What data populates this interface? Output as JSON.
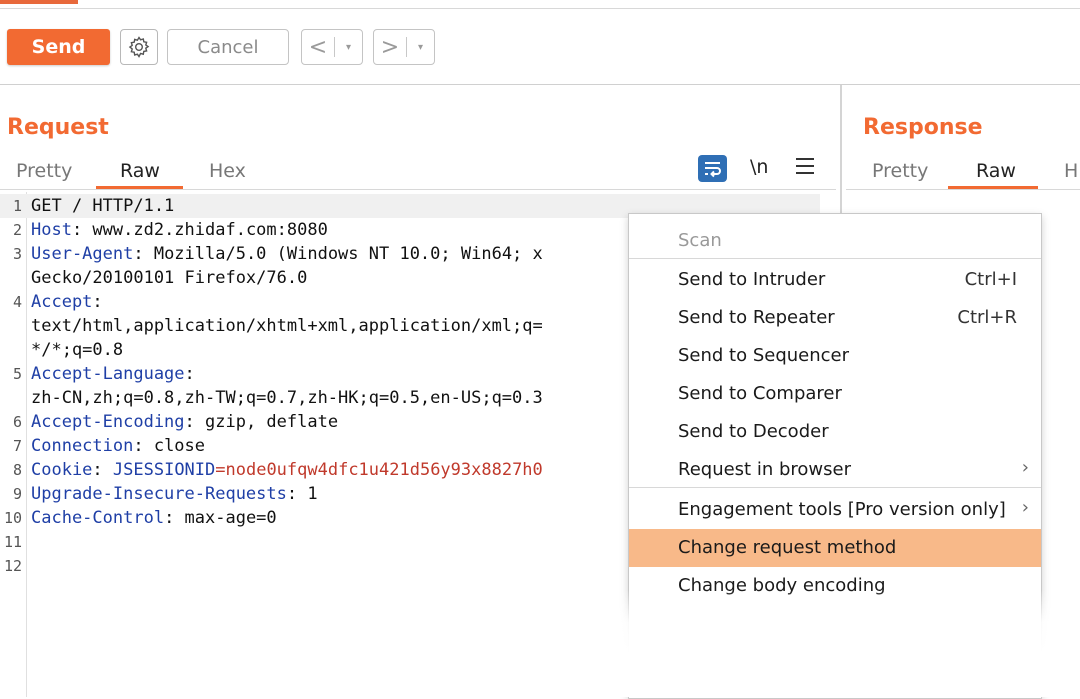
{
  "toolbar": {
    "send_label": "Send",
    "cancel_label": "Cancel",
    "back_arrow": "<",
    "forward_arrow": ">",
    "dropdown_glyph": "▾"
  },
  "request": {
    "title": "Request",
    "tabs": [
      {
        "label": "Pretty",
        "active": false
      },
      {
        "label": "Raw",
        "active": true
      },
      {
        "label": "Hex",
        "active": false
      }
    ],
    "newline_toggle": "\\n",
    "lines": [
      {
        "n": "1",
        "parts": [
          {
            "t": "GET / HTTP/1.1",
            "c": "v"
          }
        ]
      },
      {
        "n": "2",
        "parts": [
          {
            "t": "Host",
            "c": "k"
          },
          {
            "t": ": www.zd2.zhidaf.com:8080",
            "c": "v"
          }
        ]
      },
      {
        "n": "3",
        "parts": [
          {
            "t": "User-Agent",
            "c": "k"
          },
          {
            "t": ": Mozilla/5.0 (Windows NT 10.0; Win64; x",
            "c": "v"
          }
        ]
      },
      {
        "n": "",
        "parts": [
          {
            "t": "Gecko/20100101 Firefox/76.0",
            "c": "v"
          }
        ]
      },
      {
        "n": "4",
        "parts": [
          {
            "t": "Accept",
            "c": "k"
          },
          {
            "t": ":",
            "c": "v"
          }
        ]
      },
      {
        "n": "",
        "parts": [
          {
            "t": "text/html,application/xhtml+xml,application/xml;q=",
            "c": "v"
          }
        ]
      },
      {
        "n": "",
        "parts": [
          {
            "t": "*/*;q=0.8",
            "c": "v"
          }
        ]
      },
      {
        "n": "5",
        "parts": [
          {
            "t": "Accept-Language",
            "c": "k"
          },
          {
            "t": ":",
            "c": "v"
          }
        ]
      },
      {
        "n": "",
        "parts": [
          {
            "t": "zh-CN,zh;q=0.8,zh-TW;q=0.7,zh-HK;q=0.5,en-US;q=0.3",
            "c": "v"
          }
        ]
      },
      {
        "n": "6",
        "parts": [
          {
            "t": "Accept-Encoding",
            "c": "k"
          },
          {
            "t": ": gzip, deflate",
            "c": "v"
          }
        ]
      },
      {
        "n": "7",
        "parts": [
          {
            "t": "Connection",
            "c": "k"
          },
          {
            "t": ": close",
            "c": "v"
          }
        ]
      },
      {
        "n": "8",
        "parts": [
          {
            "t": "Cookie",
            "c": "k"
          },
          {
            "t": ": ",
            "c": "v"
          },
          {
            "t": "JSESSIONID",
            "c": "k"
          },
          {
            "t": "=node0ufqw4dfc1u421d56y93x8827h0",
            "c": "r"
          }
        ]
      },
      {
        "n": "9",
        "parts": [
          {
            "t": "Upgrade-Insecure-Requests",
            "c": "k"
          },
          {
            "t": ": 1",
            "c": "v"
          }
        ]
      },
      {
        "n": "10",
        "parts": [
          {
            "t": "Cache-Control",
            "c": "k"
          },
          {
            "t": ": max-age=0",
            "c": "v"
          }
        ]
      },
      {
        "n": "11",
        "parts": []
      },
      {
        "n": "12",
        "parts": []
      }
    ]
  },
  "response": {
    "title": "Response",
    "tabs": [
      {
        "label": "Pretty",
        "active": false
      },
      {
        "label": "Raw",
        "active": true
      },
      {
        "label": "H",
        "active": false
      }
    ]
  },
  "context_menu": {
    "items": [
      {
        "label": "Scan",
        "shortcut": "",
        "submenu": false,
        "disabled": true,
        "highlighted": false
      },
      {
        "label": "Send to Intruder",
        "shortcut": "Ctrl+I",
        "submenu": false,
        "disabled": false,
        "highlighted": false
      },
      {
        "label": "Send to Repeater",
        "shortcut": "Ctrl+R",
        "submenu": false,
        "disabled": false,
        "highlighted": false
      },
      {
        "label": "Send to Sequencer",
        "shortcut": "",
        "submenu": false,
        "disabled": false,
        "highlighted": false
      },
      {
        "label": "Send to Comparer",
        "shortcut": "",
        "submenu": false,
        "disabled": false,
        "highlighted": false
      },
      {
        "label": "Send to Decoder",
        "shortcut": "",
        "submenu": false,
        "disabled": false,
        "highlighted": false
      },
      {
        "label": "Request in browser",
        "shortcut": "",
        "submenu": true,
        "disabled": false,
        "highlighted": false
      },
      {
        "label": "Engagement tools [Pro version only]",
        "shortcut": "",
        "submenu": true,
        "disabled": false,
        "highlighted": false
      },
      {
        "label": "Change request method",
        "shortcut": "",
        "submenu": false,
        "disabled": false,
        "highlighted": true
      },
      {
        "label": "Change body encoding",
        "shortcut": "",
        "submenu": false,
        "disabled": false,
        "highlighted": false
      }
    ]
  },
  "colors": {
    "accent": "#f26a32",
    "highlight": "#f8b989",
    "header_key": "#1f3fa6",
    "cookie_value": "#c0392b"
  }
}
